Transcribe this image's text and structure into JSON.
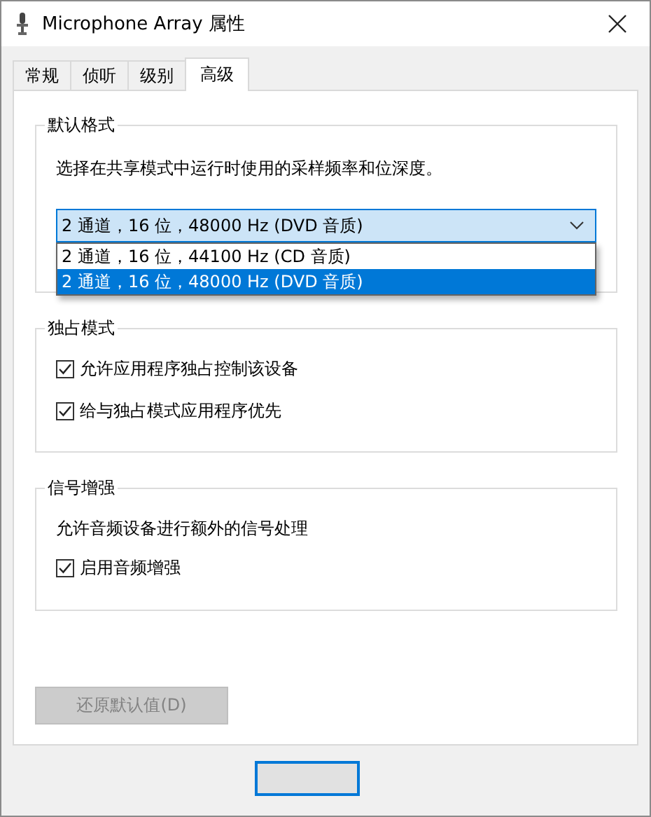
{
  "window": {
    "title": "Microphone Array 属性"
  },
  "tabs": [
    {
      "label": "常规",
      "selected": false
    },
    {
      "label": "侦听",
      "selected": false
    },
    {
      "label": "级别",
      "selected": false
    },
    {
      "label": "高级",
      "selected": true
    }
  ],
  "default_format": {
    "title": "默认格式",
    "description": "选择在共享模式中运行时使用的采样频率和位深度。",
    "dropdown": {
      "value": "2 通道，16 位，48000 Hz (DVD 音质)",
      "expanded": true,
      "options": [
        {
          "label": "2 通道，16 位，44100 Hz (CD 音质)",
          "selected": false
        },
        {
          "label": "2 通道，16 位，48000 Hz (DVD 音质)",
          "selected": true
        }
      ]
    }
  },
  "exclusive_mode": {
    "title": "独占模式",
    "options": [
      {
        "label": "允许应用程序独占控制该设备",
        "checked": true
      },
      {
        "label": "给与独占模式应用程序优先",
        "checked": true
      }
    ]
  },
  "signal_enhancements": {
    "title": "信号增强",
    "description": "允许音频设备进行额外的信号处理",
    "options": [
      {
        "label": "启用音频增强",
        "checked": true
      }
    ]
  },
  "restore_button": {
    "label": "还原默认值(D)",
    "disabled": true
  }
}
